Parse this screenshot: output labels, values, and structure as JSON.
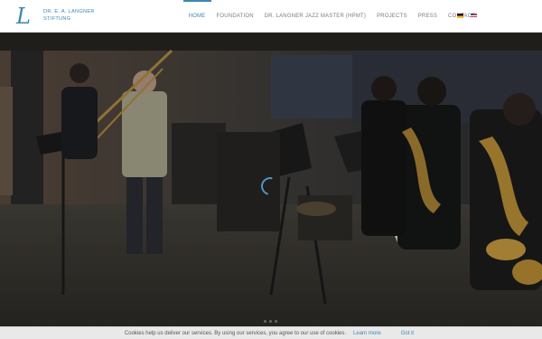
{
  "brand": {
    "logo_letter": "L",
    "line1": "DR. E. A. LANGNER",
    "line2": "STIFTUNG"
  },
  "nav": {
    "items": [
      {
        "label": "HOME",
        "active": true
      },
      {
        "label": "FOUNDATION",
        "active": false
      },
      {
        "label": "DR. LANGNER JAZZ MASTER (HPMT)",
        "active": false
      },
      {
        "label": "PROJECTS",
        "active": false
      },
      {
        "label": "PRESS",
        "active": false
      },
      {
        "label": "CONTACT",
        "active": false
      }
    ],
    "languages": [
      "de-flag-icon",
      "en-flag-icon"
    ]
  },
  "hero": {
    "loading": "loading-spinner-icon",
    "slides": 3
  },
  "cookie": {
    "text": "Cookies help us deliver our services. By using our services, you agree to our use of cookies.",
    "learn_more": "Learn more",
    "accept": "Got it"
  },
  "colors": {
    "accent": "#3c86b4",
    "nav_text": "#7d7d7d",
    "cookie_bg": "#e9e9e9"
  }
}
